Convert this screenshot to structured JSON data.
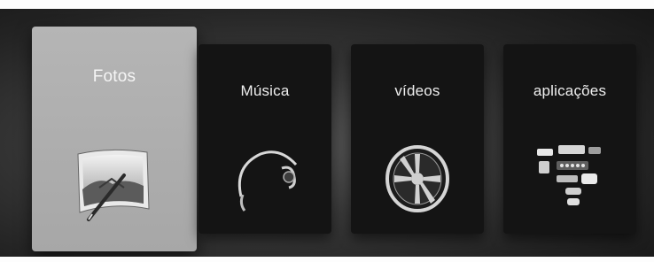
{
  "menu": {
    "items": [
      {
        "label": "Fotos",
        "icon": "photo-frame-icon",
        "selected": true
      },
      {
        "label": "Música",
        "icon": "headphones-icon",
        "selected": false
      },
      {
        "label": "vídeos",
        "icon": "film-reel-icon",
        "selected": false
      },
      {
        "label": "aplicações",
        "icon": "apps-icon",
        "selected": false
      }
    ]
  },
  "colors": {
    "tile_bg": "#141414",
    "focused_tile_bg": "#adadad",
    "label": "#efefef"
  }
}
